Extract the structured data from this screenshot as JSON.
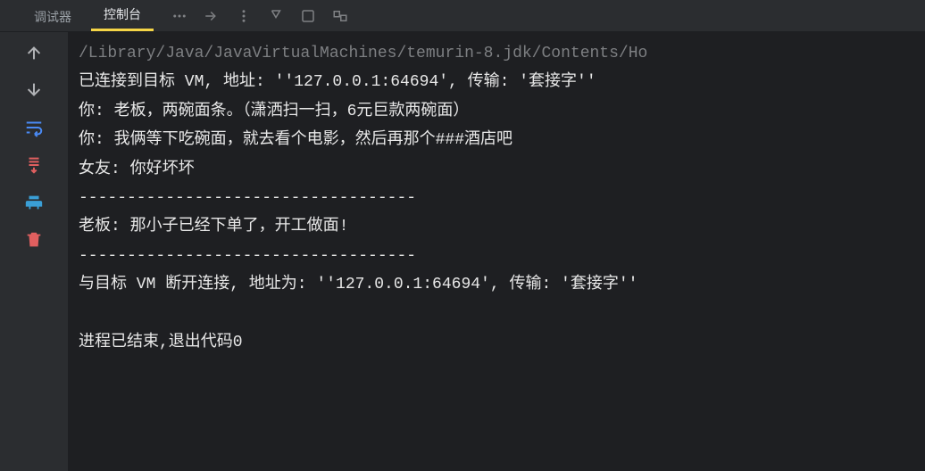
{
  "tabs": {
    "debugger": "调试器",
    "console": "控制台"
  },
  "toolbar_icons": {
    "arrow_up": "arrow-up-icon",
    "arrow_down": "arrow-down-icon",
    "wrap": "wrap-icon",
    "scroll_end": "scroll-to-end-icon",
    "print": "print-icon",
    "delete": "delete-icon"
  },
  "tab_strip_icons": {
    "a": "overflow-menu-icon",
    "b": "step-icon",
    "c": "more-icon",
    "d": "settings-icon",
    "e": "view-icon",
    "f": "layout-icon"
  },
  "console": {
    "lines": [
      {
        "type": "path",
        "text": "/Library/Java/JavaVirtualMachines/temurin-8.jdk/Contents/Ho"
      },
      {
        "type": "out",
        "text": "已连接到目标 VM, 地址: ''127.0.0.1:64694', 传输: '套接字''"
      },
      {
        "type": "out",
        "text": "你: 老板，两碗面条。（潇洒扫一扫，6元巨款两碗面）"
      },
      {
        "type": "out",
        "text": "你: 我俩等下吃碗面，就去看个电影，然后再那个###酒店吧"
      },
      {
        "type": "out",
        "text": "女友: 你好坏坏"
      },
      {
        "type": "out",
        "text": "-----------------------------------"
      },
      {
        "type": "out",
        "text": "老板: 那小子已经下单了，开工做面!"
      },
      {
        "type": "out",
        "text": "-----------------------------------"
      },
      {
        "type": "out",
        "text": "与目标 VM 断开连接, 地址为: ''127.0.0.1:64694', 传输: '套接字''"
      },
      {
        "type": "blank",
        "text": ""
      },
      {
        "type": "out",
        "text": "进程已结束,退出代码0"
      }
    ]
  }
}
